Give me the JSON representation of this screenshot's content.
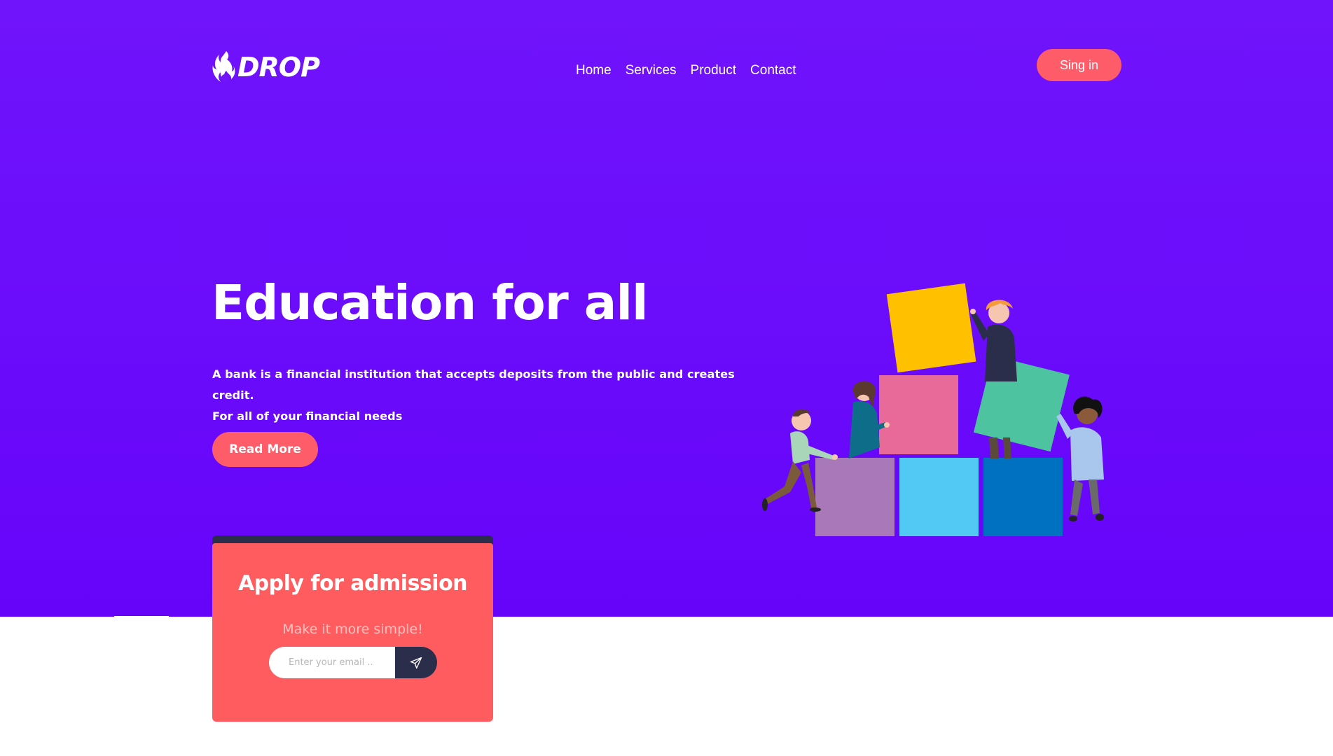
{
  "brand": {
    "name": "DROP"
  },
  "nav": {
    "items": [
      {
        "label": "Home"
      },
      {
        "label": "Services"
      },
      {
        "label": "Product"
      },
      {
        "label": "Contact"
      }
    ],
    "signin_label": "Sing in"
  },
  "hero": {
    "title": "Education for all",
    "description_line1": "A bank is a financial institution that accepts deposits from the public and creates credit.",
    "description_line2": "For all of your financial needs",
    "cta_label": "Read More"
  },
  "admission": {
    "title": "Apply for admission",
    "subtitle": "Make it more simple!",
    "email_placeholder": "Enter your email ..",
    "send_icon": "paper-plane-icon"
  },
  "colors": {
    "hero_bg": "#6a0cfa",
    "accent": "#ff5c6a",
    "dark": "#2b2e4a",
    "white": "#ffffff"
  }
}
